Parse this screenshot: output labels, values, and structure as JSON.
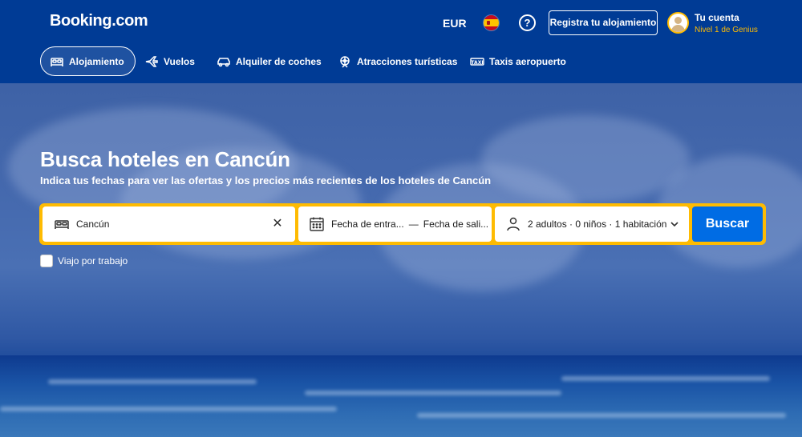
{
  "header": {
    "logo": "Booking.com",
    "currency": "EUR",
    "language_flag": "spain-flag",
    "help_icon": "?",
    "register_button": "Registra tu alojamiento",
    "account": {
      "name": "Tu cuenta",
      "level": "Nivel 1 de Genius"
    }
  },
  "nav": {
    "items": [
      {
        "label": "Alojamiento",
        "icon": "bed-icon",
        "active": true
      },
      {
        "label": "Vuelos",
        "icon": "plane-icon",
        "active": false
      },
      {
        "label": "Alquiler de coches",
        "icon": "car-icon",
        "active": false
      },
      {
        "label": "Atracciones turísticas",
        "icon": "attraction-icon",
        "active": false
      },
      {
        "label": "Taxis aeropuerto",
        "icon": "taxi-icon",
        "active": false
      }
    ]
  },
  "hero": {
    "title": "Busca hoteles en Cancún",
    "subtitle": "Indica tus fechas para ver las ofertas y los precios más recientes de los hoteles de Cancún"
  },
  "search": {
    "destination_value": "Cancún",
    "checkin_placeholder": "Fecha de entra...",
    "checkout_placeholder": "Fecha de sali...",
    "date_separator": "—",
    "guests_value": "2 adultos · 0 niños · 1 habitación",
    "search_button": "Buscar",
    "work_trip_label": "Viajo por trabajo"
  },
  "colors": {
    "brand_blue": "#003b95",
    "accent_yellow": "#febb02",
    "button_blue": "#006ce4"
  }
}
